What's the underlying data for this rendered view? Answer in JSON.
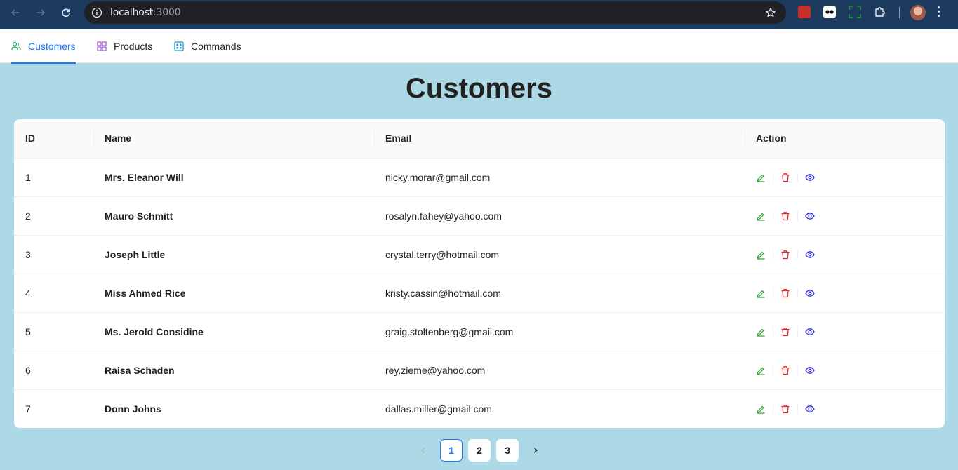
{
  "browser": {
    "url_host": "localhost",
    "url_port": ":3000"
  },
  "tabs": [
    {
      "label": "Customers",
      "icon": "users-icon",
      "active": true
    },
    {
      "label": "Products",
      "icon": "grid-icon",
      "active": false
    },
    {
      "label": "Commands",
      "icon": "command-icon",
      "active": false
    }
  ],
  "page": {
    "title": "Customers"
  },
  "table": {
    "columns": [
      "ID",
      "Name",
      "Email",
      "Action"
    ],
    "rows": [
      {
        "id": "1",
        "name": "Mrs. Eleanor Will",
        "email": "nicky.morar@gmail.com"
      },
      {
        "id": "2",
        "name": "Mauro Schmitt",
        "email": "rosalyn.fahey@yahoo.com"
      },
      {
        "id": "3",
        "name": "Joseph Little",
        "email": "crystal.terry@hotmail.com"
      },
      {
        "id": "4",
        "name": "Miss Ahmed Rice",
        "email": "kristy.cassin@hotmail.com"
      },
      {
        "id": "5",
        "name": "Ms. Jerold Considine",
        "email": "graig.stoltenberg@gmail.com"
      },
      {
        "id": "6",
        "name": "Raisa Schaden",
        "email": "rey.zieme@yahoo.com"
      },
      {
        "id": "7",
        "name": "Donn Johns",
        "email": "dallas.miller@gmail.com"
      }
    ]
  },
  "pagination": {
    "pages": [
      "1",
      "2",
      "3"
    ],
    "current": "1"
  },
  "colors": {
    "accent": "#1677ff",
    "background": "#add8e6",
    "edit": "#2e9e2e",
    "delete": "#e0282e",
    "view": "#2b2bd6"
  }
}
